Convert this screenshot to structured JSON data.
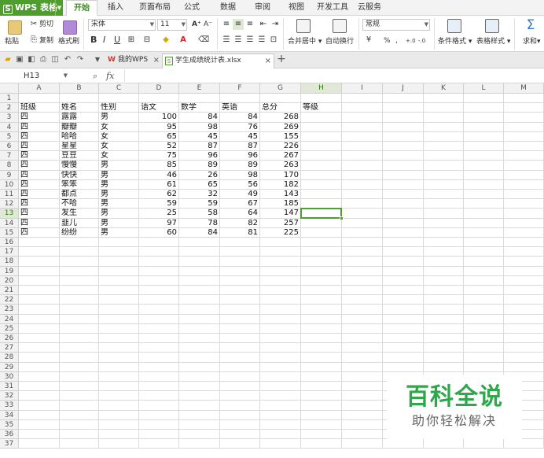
{
  "app": {
    "name": "WPS 表格"
  },
  "menu": {
    "tabs": [
      "开始",
      "插入",
      "页面布局",
      "公式",
      "数据",
      "审阅",
      "视图",
      "开发工具",
      "云服务"
    ],
    "active": "开始"
  },
  "ribbon": {
    "paste": "粘贴",
    "cut": "剪切",
    "copy": "复制",
    "format_painter": "格式刷",
    "font_name": "宋体",
    "font_size": "11",
    "merge_center": "合并居中",
    "wrap_text": "自动换行",
    "number_format": "常规",
    "percent": "%",
    "conditional_format": "条件格式",
    "table_style": "表格样式",
    "sum": "求和",
    "bold": "B",
    "italic": "I",
    "underline": "U",
    "font_grow": "A⁺",
    "font_shrink": "A⁻",
    "thousands": ",",
    "dec_inc": "+.0",
    "dec_dec": "-.0"
  },
  "tabs": {
    "home": "我的WPS",
    "file": "学生成绩统计表.xlsx"
  },
  "formula_bar": {
    "name_box": "H13",
    "fx": "fx",
    "content": ""
  },
  "sheet": {
    "columns": [
      "A",
      "B",
      "C",
      "D",
      "E",
      "F",
      "G",
      "H",
      "I",
      "J",
      "K",
      "L",
      "M"
    ],
    "selected_column": "H",
    "selected_row": 13,
    "header_row_number": 2,
    "headers": [
      "班级",
      "姓名",
      "性别",
      "语文",
      "数学",
      "英语",
      "总分",
      "等级"
    ],
    "rows": [
      [
        "四",
        "露露",
        "男",
        "100",
        "84",
        "84",
        "268",
        ""
      ],
      [
        "四",
        "瓣瓣",
        "女",
        "95",
        "98",
        "76",
        "269",
        ""
      ],
      [
        "四",
        "哈哈",
        "女",
        "65",
        "45",
        "45",
        "155",
        ""
      ],
      [
        "四",
        "星星",
        "女",
        "52",
        "87",
        "87",
        "226",
        ""
      ],
      [
        "四",
        "豆豆",
        "女",
        "75",
        "96",
        "96",
        "267",
        ""
      ],
      [
        "四",
        "慢慢",
        "男",
        "85",
        "89",
        "89",
        "263",
        ""
      ],
      [
        "四",
        "快快",
        "男",
        "46",
        "26",
        "98",
        "170",
        ""
      ],
      [
        "四",
        "笨笨",
        "男",
        "61",
        "65",
        "56",
        "182",
        ""
      ],
      [
        "四",
        "都点",
        "男",
        "62",
        "32",
        "49",
        "143",
        ""
      ],
      [
        "四",
        "不哈",
        "男",
        "59",
        "59",
        "67",
        "185",
        ""
      ],
      [
        "四",
        "发生",
        "男",
        "25",
        "58",
        "64",
        "147",
        ""
      ],
      [
        "四",
        "韭儿",
        "男",
        "97",
        "78",
        "82",
        "257",
        ""
      ],
      [
        "四",
        "纷纷",
        "男",
        "60",
        "84",
        "81",
        "225",
        ""
      ]
    ],
    "visible_row_numbers": [
      1,
      2,
      3,
      4,
      5,
      6,
      7,
      8,
      9,
      10,
      11,
      12,
      13,
      14,
      15,
      16,
      17,
      18,
      19,
      20,
      21,
      22,
      23,
      24,
      25,
      26,
      27,
      28,
      29,
      30,
      31,
      32,
      33,
      34,
      35,
      36,
      37
    ]
  },
  "watermark": {
    "title": "百科全说",
    "subtitle": "助你轻松解决"
  },
  "colors": {
    "accent": "#4f9d2e",
    "watermark_green": "#2ea84a"
  }
}
